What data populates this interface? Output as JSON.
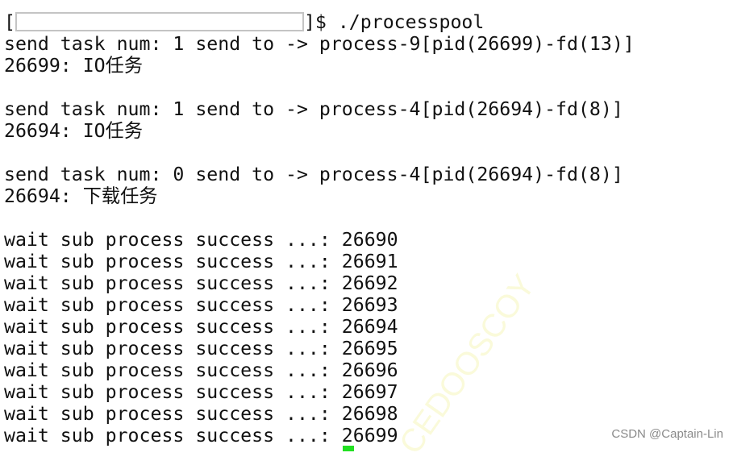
{
  "terminal": {
    "prompt_prefix": "[",
    "prompt_suffix": "]$ ./processpool",
    "lines": [
      "send task num: 1 send to -> process-9[pid(26699)-fd(13)]",
      "26699: IO任务",
      "",
      "send task num: 1 send to -> process-4[pid(26694)-fd(8)]",
      "26694: IO任务",
      "",
      "send task num: 0 send to -> process-4[pid(26694)-fd(8)]",
      "26694: 下载任务",
      "",
      "wait sub process success ...: 26690",
      "wait sub process success ...: 26691",
      "wait sub process success ...: 26692",
      "wait sub process success ...: 26693",
      "wait sub process success ...: 26694",
      "wait sub process success ...: 26695",
      "wait sub process success ...: 26696",
      "wait sub process success ...: 26697",
      "wait sub process success ...: 26698",
      "wait sub process success ...: 26699"
    ]
  },
  "watermark": "CSDN @Captain-Lin",
  "background_watermark": "CEDOOSCOY",
  "cursor_color": "#22e022"
}
